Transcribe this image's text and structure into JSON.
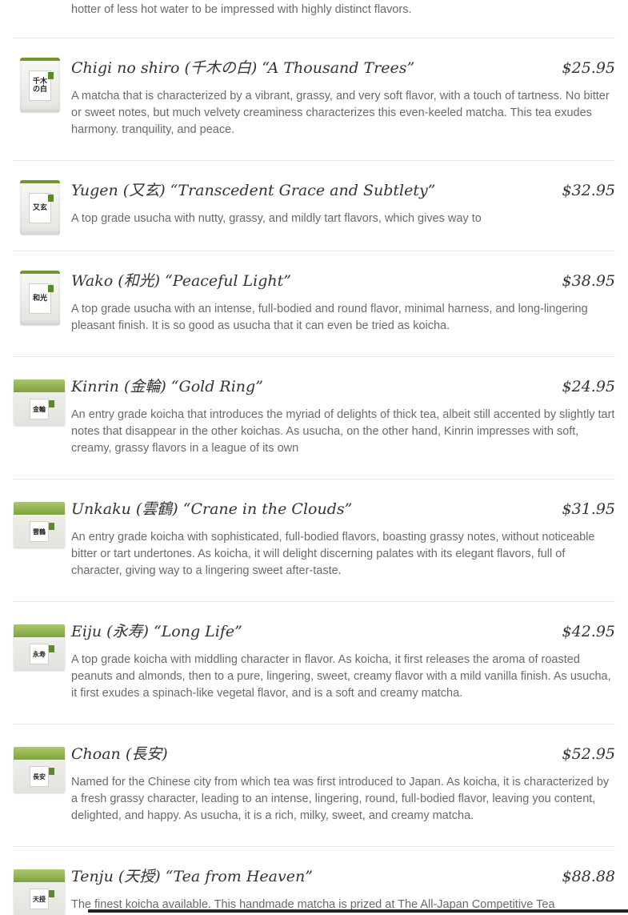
{
  "intro_text": "hotter of less hot water to be impressed with highly distinct flavors.",
  "products": [
    {
      "name": "Chigi no shiro (千木の白) “A Thousand Trees”",
      "price": "$25.95",
      "description": "A matcha that is characterized by a vibrant, grassy, and very soft flavor, with a touch of tartness. No bitter or sweet notes, but much velvety creaminess characterizes this even-keeled matcha. This tea exudes harmony. tranquility, and peace.",
      "tin_label": "千木の白"
    },
    {
      "name": "Yugen (又玄) “Transcedent Grace and Subtlety”",
      "price": "$32.95",
      "description": "A top grade usucha with nutty, grassy, and mildly tart flavors, which gives way to",
      "tin_label": "又玄"
    },
    {
      "name": "Wako (和光) “Peaceful Light”",
      "price": "$38.95",
      "description": "A top grade usucha with an intense, full-bodied and round flavor, minimal harness, and long-lingering pleasant finish. It is so good as usucha that it can even be tried as koicha.",
      "tin_label": "和光"
    },
    {
      "name": "Kinrin (金輪) “Gold Ring”",
      "price": "$24.95",
      "description": "An entry grade koicha that introduces the myriad of delights of thick tea, albeit still accented by slightly tart notes that disappear in the other koichas. As usucha, on the other hand, Kinrin impresses with soft, creamy, grassy flavors in a league of its own",
      "tin_label": "金輪"
    },
    {
      "name": "Unkaku (雲鶴) “Crane in the Clouds”",
      "price": "$31.95",
      "description": "An entry grade koicha with sophisticated, full-bodied flavors, boasting grassy notes, without noticeable bitter or tart undertones. As koicha, it will delight discerning palates with its elegant flavors, full of character, giving way to a lingering sweet after-taste.",
      "tin_label": "雲鶴"
    },
    {
      "name": "Eiju (永寿) “Long Life”",
      "price": "$42.95",
      "description": "A top grade koicha with middling character in flavor. As koicha, it first releases the aroma of roasted peanuts and almonds, then to a pure, lingering, sweet, creamy flavor with a mild vanilla finish. As usucha, it first exudes a spinach-like vegetal flavor, and is a soft and creamy matcha.",
      "tin_label": "永寿"
    },
    {
      "name": "Choan (長安)",
      "price": "$52.95",
      "description": "Named for the Chinese city from which tea was first introduced to Japan. As koicha, it is characterized by a fresh grassy character, leading to an intense, lingering, round, full-bodied flavor, leaving you content, delighted, and happy. As usucha, it is a rich, milky, sweet, and creamy matcha.",
      "tin_label": "長安"
    },
    {
      "name": "Tenju (天授) “Tea from Heaven”",
      "price": "$88.88",
      "description": "The finest koicha available. This handmade matcha is prized at The All-Japan Competitive Tea",
      "tin_label": "天授"
    }
  ]
}
